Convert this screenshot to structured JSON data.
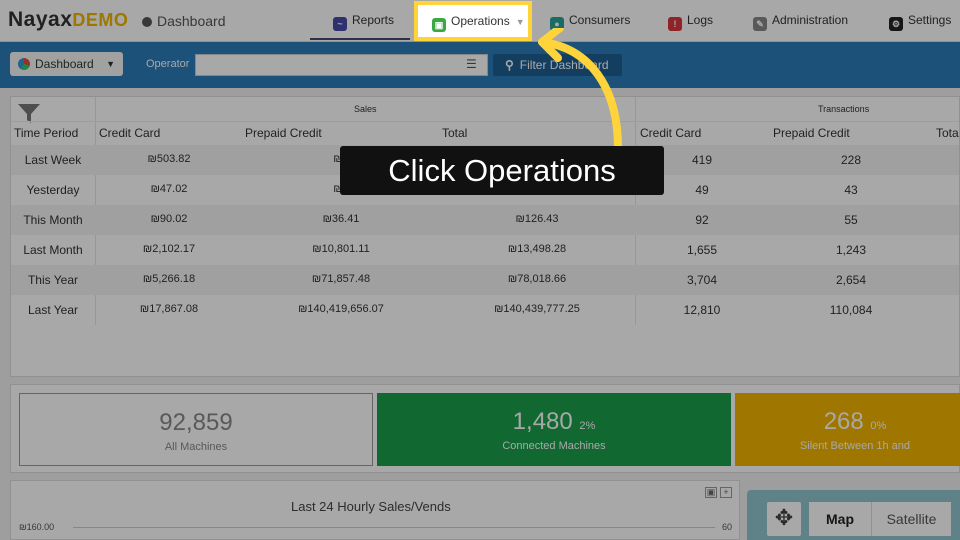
{
  "header": {
    "brand": "Nayax",
    "brand_suffix": "DEMO",
    "page_title": "Dashboard",
    "nav": {
      "reports": "Reports",
      "operations": "Operations",
      "consumers": "Consumers",
      "logs": "Logs",
      "administration": "Administration",
      "settings": "Settings"
    }
  },
  "filterbar": {
    "dashboard_select": "Dashboard",
    "operator_label": "Operator",
    "operator_value": "",
    "filter_button": "Filter Dashboard"
  },
  "table": {
    "group_headers": {
      "sales": "Sales",
      "transactions": "Transactions"
    },
    "columns": [
      "Time Period",
      "Credit Card",
      "Prepaid Credit",
      "Total",
      "Credit Card",
      "Prepaid Credit",
      "Total"
    ],
    "rows": [
      {
        "period": "Last Week",
        "cc": "₪503.82",
        "pp": "₪1",
        "total": "",
        "tx_cc": "419",
        "tx_pp": "228"
      },
      {
        "period": "Yesterday",
        "cc": "₪47.02",
        "pp": "₪2",
        "total": "",
        "tx_cc": "49",
        "tx_pp": "43"
      },
      {
        "period": "This Month",
        "cc": "₪90.02",
        "pp": "₪36.41",
        "total": "₪126.43",
        "tx_cc": "92",
        "tx_pp": "55"
      },
      {
        "period": "Last Month",
        "cc": "₪2,102.17",
        "pp": "₪10,801.11",
        "total": "₪13,498.28",
        "tx_cc": "1,655",
        "tx_pp": "1,243"
      },
      {
        "period": "This Year",
        "cc": "₪5,266.18",
        "pp": "₪71,857.48",
        "total": "₪78,018.66",
        "tx_cc": "3,704",
        "tx_pp": "2,654"
      },
      {
        "period": "Last Year",
        "cc": "₪17,867.08",
        "pp": "₪140,419,656.07",
        "total": "₪140,439,777.25",
        "tx_cc": "12,810",
        "tx_pp": "110,084"
      }
    ]
  },
  "tiles": {
    "all": {
      "value": "92,859",
      "label": "All Machines"
    },
    "connected": {
      "value": "1,480",
      "percent": "2%",
      "label": "Connected Machines"
    },
    "silent": {
      "value": "268",
      "percent": "0%",
      "label": "Silent Between 1h and"
    }
  },
  "chart": {
    "title": "Last 24 Hourly Sales/Vends",
    "y_left_top": "₪160.00",
    "y_right_top": "60"
  },
  "map": {
    "map_label": "Map",
    "satellite_label": "Satellite"
  },
  "tutorial": {
    "callout": "Click Operations"
  },
  "colors": {
    "highlight": "#ffd43b",
    "filterbar": "#2b7bb9",
    "connected": "#1a9e49",
    "silent": "#f0b400"
  }
}
